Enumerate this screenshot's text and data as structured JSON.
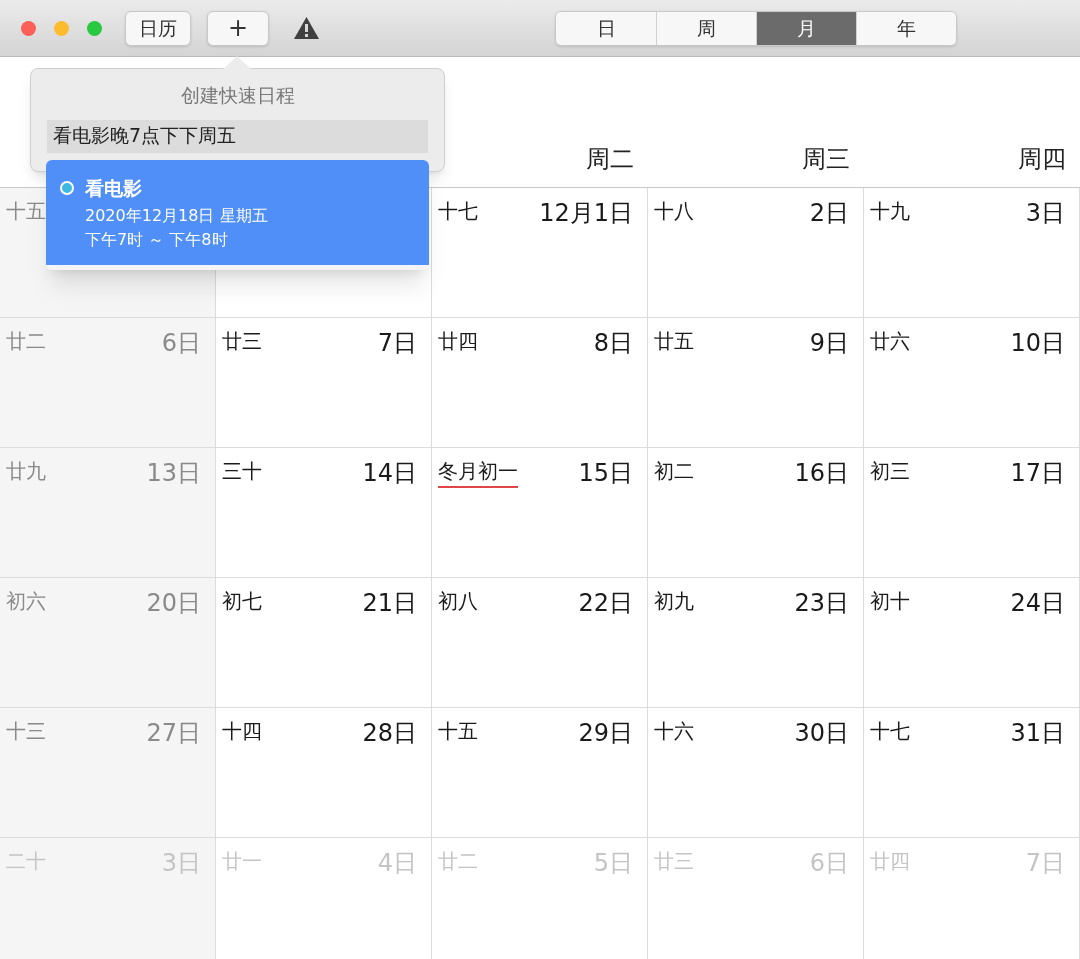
{
  "toolbar": {
    "calendars_button": "日历",
    "add_button": "+",
    "views": [
      {
        "label": "日",
        "selected": false
      },
      {
        "label": "周",
        "selected": false
      },
      {
        "label": "月",
        "selected": true
      },
      {
        "label": "年",
        "selected": false
      }
    ]
  },
  "weekday_headers": [
    "周二",
    "周三",
    "周四"
  ],
  "weeks": [
    {
      "dimmed": false,
      "days": [
        {
          "lunar": "十五",
          "marked": false
        },
        {
          "lunar": "十七",
          "date": "12月1日",
          "marked": false
        },
        {
          "lunar": "十八",
          "date": "2日",
          "marked": false
        },
        {
          "lunar": "十九",
          "date": "3日",
          "marked": false
        }
      ]
    },
    {
      "dimmed": false,
      "days": [
        {
          "lunar": "廿二",
          "date": "6日",
          "marked": false
        },
        {
          "lunar": "廿三",
          "date": "7日",
          "marked": false
        },
        {
          "lunar": "廿四",
          "date": "8日",
          "marked": false
        },
        {
          "lunar": "廿五",
          "date": "9日",
          "marked": false
        },
        {
          "lunar": "廿六",
          "date": "10日",
          "marked": false
        }
      ]
    },
    {
      "dimmed": false,
      "days": [
        {
          "lunar": "廿九",
          "date": "13日",
          "marked": false
        },
        {
          "lunar": "三十",
          "date": "14日",
          "marked": false
        },
        {
          "lunar": "冬月初一",
          "date": "15日",
          "marked": true
        },
        {
          "lunar": "初二",
          "date": "16日",
          "marked": false
        },
        {
          "lunar": "初三",
          "date": "17日",
          "marked": false
        }
      ]
    },
    {
      "dimmed": false,
      "days": [
        {
          "lunar": "初六",
          "date": "20日",
          "marked": false
        },
        {
          "lunar": "初七",
          "date": "21日",
          "marked": false
        },
        {
          "lunar": "初八",
          "date": "22日",
          "marked": false
        },
        {
          "lunar": "初九",
          "date": "23日",
          "marked": false
        },
        {
          "lunar": "初十",
          "date": "24日",
          "marked": false
        }
      ]
    },
    {
      "dimmed": false,
      "days": [
        {
          "lunar": "十三",
          "date": "27日",
          "marked": false
        },
        {
          "lunar": "十四",
          "date": "28日",
          "marked": false
        },
        {
          "lunar": "十五",
          "date": "29日",
          "marked": false
        },
        {
          "lunar": "十六",
          "date": "30日",
          "marked": false
        },
        {
          "lunar": "十七",
          "date": "31日",
          "marked": false
        }
      ]
    },
    {
      "dimmed": true,
      "days": [
        {
          "lunar": "二十",
          "date": "3日",
          "marked": false
        },
        {
          "lunar": "廿一",
          "date": "4日",
          "marked": false
        },
        {
          "lunar": "廿二",
          "date": "5日",
          "marked": false
        },
        {
          "lunar": "廿三",
          "date": "6日",
          "marked": false
        },
        {
          "lunar": "廿四",
          "date": "7日",
          "marked": false
        }
      ]
    }
  ],
  "quick_event": {
    "title": "创建快速日程",
    "value": "看电影晚7点下下周五",
    "suggestions": [
      {
        "title": "看电影",
        "date": "2020年12月18日 星期五",
        "time": "下午7时 ～ 下午8时",
        "selected": true,
        "color": "#3fb8e0"
      }
    ]
  }
}
